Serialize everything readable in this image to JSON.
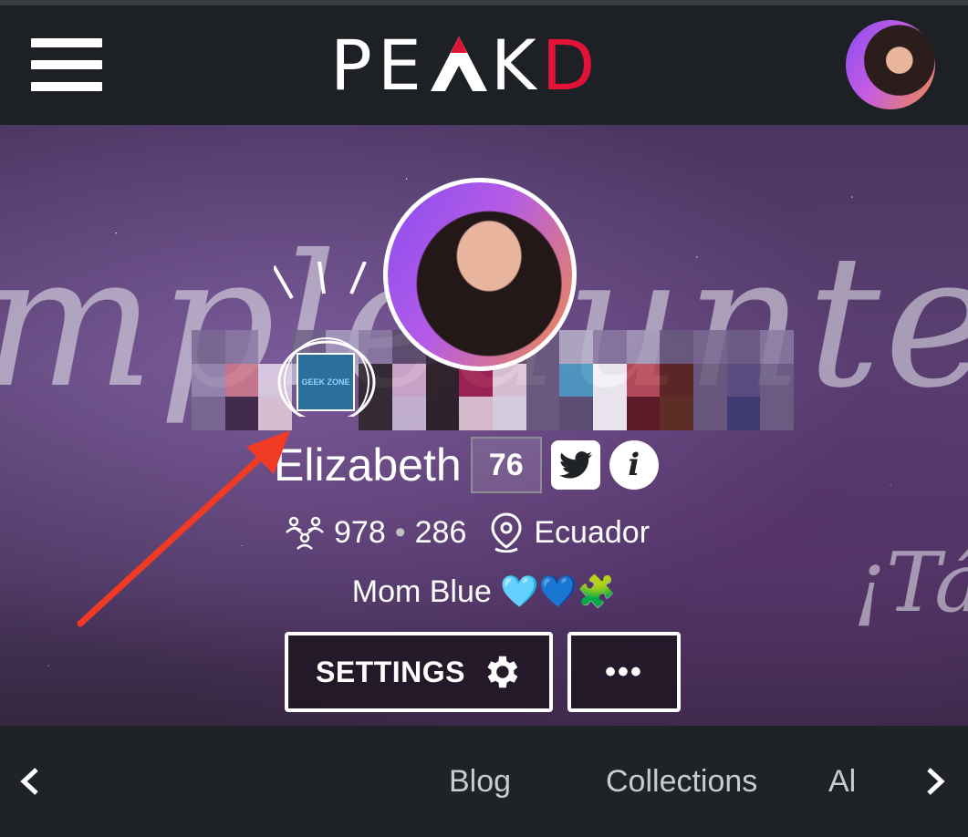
{
  "header": {
    "logo_text_left": "PE",
    "logo_text_mid": "KD",
    "logo_letter_a": "A",
    "logo_brand": "PEAKD",
    "accent_color": "#e31337"
  },
  "profile": {
    "name": "Elizabeth",
    "reputation": "76",
    "followers": "978",
    "separator": "•",
    "following": "286",
    "location": "Ecuador",
    "about": "Mom Blue 🩵💙🧩",
    "badge_text": "GEEK ZONE"
  },
  "cover": {
    "script_text_1": "mpleaunte E",
    "script_text_2": "¡Tá"
  },
  "buttons": {
    "settings_label": "SETTINGS",
    "more_label": "•••"
  },
  "tabs": {
    "items": [
      "Blog",
      "Collections",
      "Al"
    ]
  },
  "icons": {
    "menu": "hamburger-icon",
    "settings": "gear-icon",
    "twitter": "twitter-icon",
    "info": "info-icon",
    "followers": "followers-icon",
    "location": "location-pin-icon",
    "prev": "chevron-left-icon",
    "next": "chevron-right-icon"
  }
}
